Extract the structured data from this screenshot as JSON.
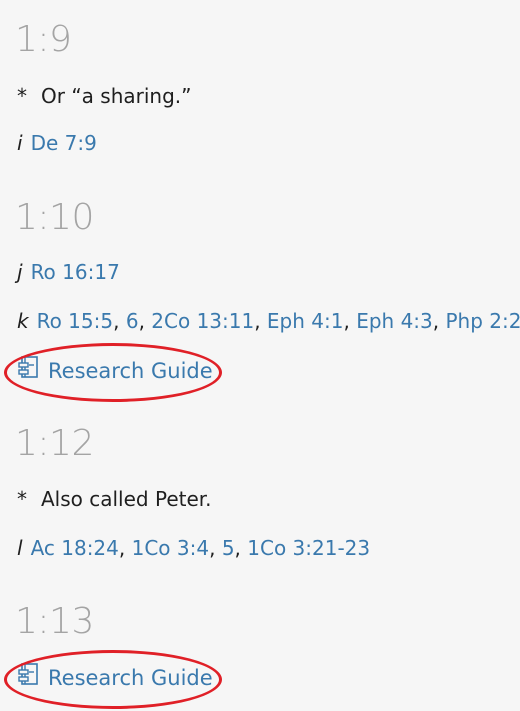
{
  "sections": [
    {
      "heading": "1:9",
      "footnote": {
        "marker": "*",
        "text": "Or “a sharing.”"
      },
      "refs": {
        "marker": "i",
        "links": [
          "De 7:9"
        ]
      }
    },
    {
      "heading": "1:10",
      "refs_j": {
        "marker": "j",
        "links": [
          "Ro 16:17"
        ]
      },
      "refs_k": {
        "marker": "k",
        "links": [
          "Ro 15:5",
          "6",
          "2Co 13:11",
          "Eph 4:1",
          "Eph 4:3",
          "Php 2:2"
        ]
      },
      "guide_label": "Research Guide"
    },
    {
      "heading": "1:12",
      "footnote": {
        "marker": "*",
        "text": "Also called Peter."
      },
      "refs": {
        "marker": "l",
        "links": [
          "Ac 18:24",
          "1Co 3:4",
          "5",
          "1Co 3:21-23"
        ]
      }
    },
    {
      "heading": "1:13",
      "guide_label": "Research Guide"
    }
  ],
  "separator": ", ",
  "annotation_color": "#e02027",
  "link_color": "#3a79ad"
}
